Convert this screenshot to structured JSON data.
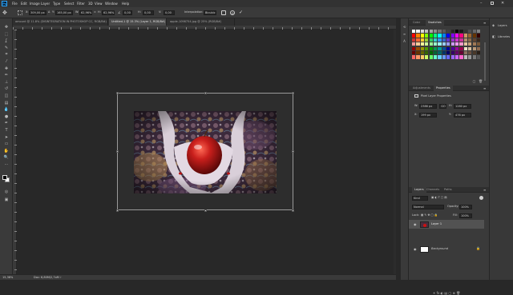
{
  "menubar": {
    "app_icon": "Ps",
    "items": [
      "File",
      "Edit",
      "Image",
      "Layer",
      "Type",
      "Select",
      "Filter",
      "3D",
      "View",
      "Window",
      "Help"
    ],
    "window_controls": [
      "minimize-icon",
      "maximize-icon",
      "close-icon"
    ]
  },
  "options_bar": {
    "w_value": "309,00 px",
    "h_value": "165,00 px",
    "scale_w": "62,96%",
    "scale_h": "62,96%",
    "angle": "0,00",
    "skew_h": "0,00",
    "skew_v": "0,00",
    "interpolation_label": "Interpolation:",
    "interpolation_value": "Bicubic",
    "cancel_icon": "cancel-icon",
    "commit_icon": "check-icon"
  },
  "tabs": [
    {
      "label": "amount @ 11.8% (DISINTEGRATION IN PHOTOSHOP CC, RGB/8#)",
      "active": false
    },
    {
      "label": "Untitled-1 @ 15.3% (Layer 1, RGB/8#)",
      "active": true
    },
    {
      "label": "apple-1098754.jpg @ 25% (RGB/8#)",
      "active": false
    }
  ],
  "status": {
    "zoom": "15,38%",
    "doc": "Doc: 6,80M/2,7oM"
  },
  "colors": {
    "accent": "#3d7bd8",
    "selection_border": "#9a9a9a",
    "canvas_bg": "#282828"
  },
  "swatches_panel": {
    "tabs": [
      {
        "label": "Color",
        "active": false
      },
      {
        "label": "Swatches",
        "active": true
      }
    ],
    "colors": [
      "#ffffff",
      "#f2f2f2",
      "#d9d9d9",
      "#bfbfbf",
      "#a6a6a6",
      "#8c8c8c",
      "#737373",
      "#595959",
      "#404040",
      "#262626",
      "#000000",
      "#1a1a1a",
      "#333333",
      "#4d4d4d",
      "#666666",
      "#808080",
      "#ff0000",
      "#ff8000",
      "#ffff00",
      "#80ff00",
      "#00ff00",
      "#00ff80",
      "#00ffff",
      "#0080ff",
      "#0000ff",
      "#8000ff",
      "#ff00ff",
      "#ff0080",
      "#cc9966",
      "#996633",
      "#663300",
      "#330000",
      "#cc3333",
      "#ff6633",
      "#ffcc33",
      "#99cc33",
      "#33cc66",
      "#33cccc",
      "#3399ff",
      "#3366cc",
      "#6633cc",
      "#9933cc",
      "#cc33cc",
      "#cc3399",
      "#b38f6b",
      "#8c6b4a",
      "#5e4330",
      "#3a2a1e",
      "#ff9999",
      "#ffcc99",
      "#ffff99",
      "#ccff99",
      "#99ff99",
      "#99ffcc",
      "#99ffff",
      "#99ccff",
      "#9999ff",
      "#cc99ff",
      "#ff99ff",
      "#ff99cc",
      "#e6c7a1",
      "#c7a07a",
      "#a07855",
      "#7a5737",
      "#990000",
      "#994c00",
      "#999900",
      "#4c9900",
      "#009900",
      "#00994c",
      "#009999",
      "#004c99",
      "#000099",
      "#4c0099",
      "#990099",
      "#99004c",
      "#f0e0c8",
      "#d8c0a0",
      "#b89878",
      "#906c50",
      "#660000",
      "#663300",
      "#666600",
      "#336600",
      "#006600",
      "#006633",
      "#006666",
      "#003366",
      "#000066",
      "#330066",
      "#660066",
      "#660033",
      "#8a7060",
      "#6a5040",
      "#4a3828",
      "#2a2018",
      "#ff6666",
      "#ff9966",
      "#ffcc66",
      "#ccff66",
      "#66ff66",
      "#66ffcc",
      "#66ccff",
      "#6699ff",
      "#6666ff",
      "#9966ff",
      "#cc66ff",
      "#ff66cc",
      "#bbbbbb",
      "#999999",
      "#777777",
      "#555555"
    ]
  },
  "properties_panel": {
    "tabs": [
      {
        "label": "Adjustments",
        "active": false
      },
      {
        "label": "Properties",
        "active": true
      }
    ],
    "title": "Pixel Layer Properties",
    "w": "2386 px",
    "link": "GO",
    "h": "1280 px",
    "x": "199 px",
    "y": "476 px"
  },
  "layers_panel": {
    "tabs": [
      {
        "label": "Layers",
        "active": true
      },
      {
        "label": "Channels",
        "active": false
      },
      {
        "label": "Paths",
        "active": false
      }
    ],
    "kind": "Kind",
    "blend_mode": "Normal",
    "opacity_label": "Opacity:",
    "opacity": "100%",
    "lock_label": "Lock:",
    "fill_label": "Fill:",
    "fill": "100%",
    "layers": [
      {
        "name": "Layer 1",
        "selected": true,
        "visible": true,
        "locked": false
      },
      {
        "name": "Background",
        "selected": false,
        "visible": true,
        "locked": true
      }
    ]
  },
  "far_panel": {
    "items": [
      {
        "label": "Layers",
        "icon": "layers-icon"
      },
      {
        "label": "Libraries",
        "icon": "libraries-icon"
      }
    ]
  }
}
